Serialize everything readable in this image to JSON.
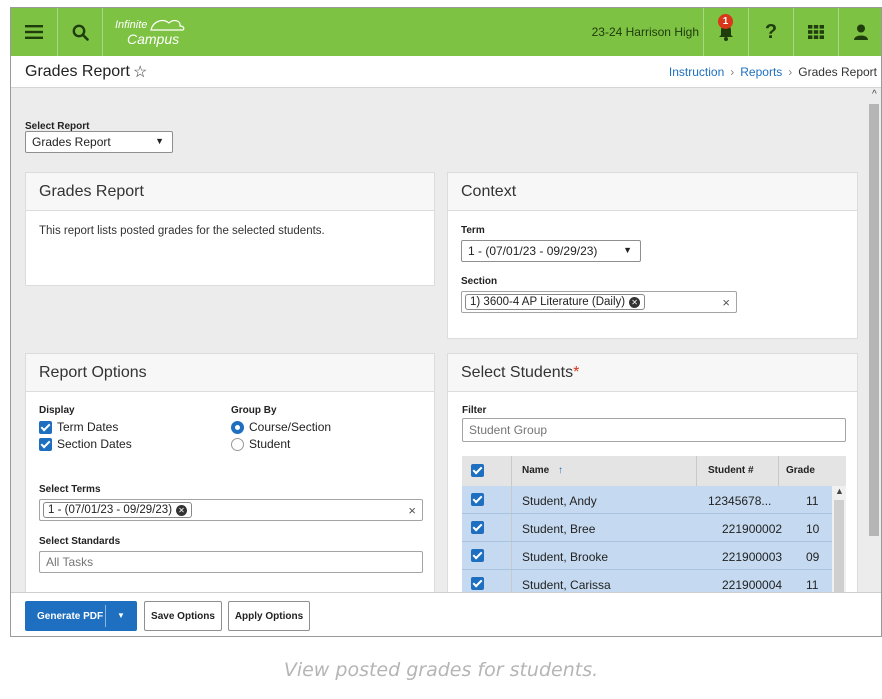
{
  "app": {
    "logo_line1": "Infinite",
    "logo_line2": "Campus",
    "school": "23-24 Harrison High",
    "notification_count": "1"
  },
  "title_bar": {
    "title": "Grades Report",
    "breadcrumb": [
      "Instruction",
      "Reports",
      "Grades Report"
    ]
  },
  "select_report": {
    "label": "Select Report",
    "value": "Grades Report"
  },
  "grades_report_card": {
    "heading": "Grades Report",
    "description": "This report lists posted grades for the selected students."
  },
  "context_card": {
    "heading": "Context",
    "term_label": "Term",
    "term_value": "1 - (07/01/23 - 09/29/23)",
    "section_label": "Section",
    "section_value": "1) 3600-4 AP Literature (Daily)"
  },
  "report_options": {
    "heading": "Report Options",
    "display_label": "Display",
    "display_options": [
      {
        "label": "Term Dates",
        "checked": true
      },
      {
        "label": "Section Dates",
        "checked": true
      }
    ],
    "group_by_label": "Group By",
    "group_by_options": [
      {
        "label": "Course/Section",
        "selected": true
      },
      {
        "label": "Student",
        "selected": false
      }
    ],
    "select_terms_label": "Select Terms",
    "select_terms_value": "1 - (07/01/23 - 09/29/23)",
    "select_standards_label": "Select Standards",
    "select_standards_placeholder": "All Tasks"
  },
  "select_students": {
    "heading": "Select Students",
    "required_mark": "*",
    "filter_label": "Filter",
    "filter_placeholder": "Student Group",
    "columns": [
      "Name",
      "Student #",
      "Grade"
    ],
    "sort_indicator": "↑",
    "rows": [
      {
        "name": "Student, Andy",
        "student_number": "12345678...",
        "grade": "11",
        "checked": true
      },
      {
        "name": "Student, Bree",
        "student_number": "221900002",
        "grade": "10",
        "checked": true
      },
      {
        "name": "Student, Brooke",
        "student_number": "221900003",
        "grade": "09",
        "checked": true
      },
      {
        "name": "Student, Carissa",
        "student_number": "221900004",
        "grade": "11",
        "checked": true
      }
    ]
  },
  "footer": {
    "generate_label": "Generate PDF",
    "save_label": "Save Options",
    "apply_label": "Apply Options"
  },
  "caption": "View posted grades for students.",
  "colors": {
    "topbar": "#7dc243",
    "accent": "#1e6fbf",
    "selected_row": "#c5daf0",
    "notification": "#d9361a"
  }
}
